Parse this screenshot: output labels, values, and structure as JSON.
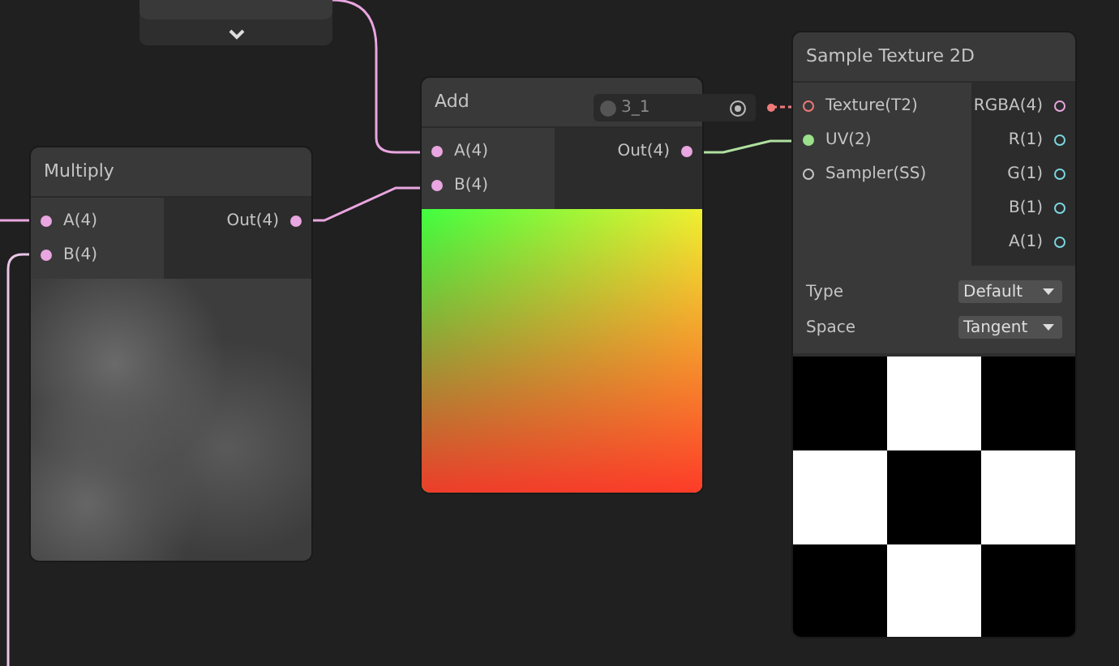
{
  "nodes": [
    {
      "title": "Multiply",
      "kind": "clouds",
      "inputs": [
        {
          "label": "A(4)",
          "color": "#e9a6e0",
          "filled": true
        },
        {
          "label": "B(4)",
          "color": "#e9a6e0",
          "filled": true
        }
      ],
      "outputs": [
        {
          "label": "Out(4)",
          "color": "#e9a6e0",
          "filled": true
        }
      ]
    },
    {
      "title": "Add",
      "kind": "gradient",
      "inputs": [
        {
          "label": "A(4)",
          "color": "#e9a6e0",
          "filled": true
        },
        {
          "label": "B(4)",
          "color": "#e9a6e0",
          "filled": true
        }
      ],
      "outputs": [
        {
          "label": "Out(4)",
          "color": "#e9a6e0",
          "filled": true
        }
      ]
    },
    {
      "title": "Sample Texture 2D",
      "kind": "texture",
      "inputs": [
        {
          "label": "Texture(T2)",
          "color": "#f07a7a",
          "filled": false
        },
        {
          "label": "UV(2)",
          "color": "#9be08a",
          "filled": true
        },
        {
          "label": "Sampler(SS)",
          "color": "#c8c8c8",
          "filled": false
        }
      ],
      "outputs": [
        {
          "label": "RGBA(4)",
          "color": "#e9a6e0",
          "filled": false
        },
        {
          "label": "R(1)",
          "color": "#7ad8e0",
          "filled": false
        },
        {
          "label": "G(1)",
          "color": "#7ad8e0",
          "filled": false
        },
        {
          "label": "B(1)",
          "color": "#7ad8e0",
          "filled": false
        },
        {
          "label": "A(1)",
          "color": "#7ad8e0",
          "filled": false
        }
      ],
      "settings": [
        {
          "label": "Type",
          "value": "Default"
        },
        {
          "label": "Space",
          "value": "Tangent"
        }
      ]
    }
  ],
  "property": {
    "name": "3_1"
  }
}
